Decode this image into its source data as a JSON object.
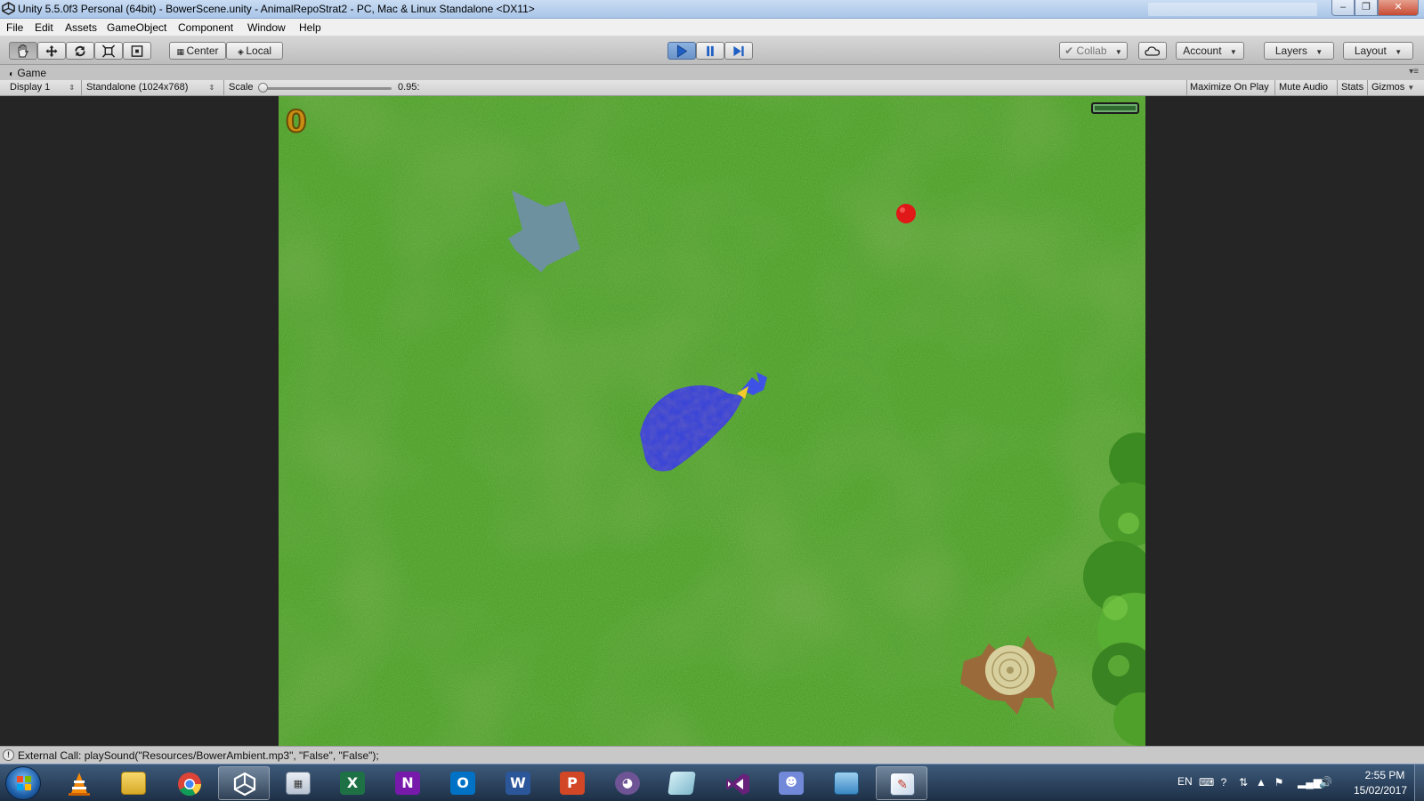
{
  "window": {
    "title": "Unity 5.5.0f3 Personal (64bit) - BowerScene.unity - AnimalRepoStrat2 - PC, Mac & Linux Standalone <DX11>",
    "minimize_glyph": "–",
    "maximize_glyph": "❐",
    "close_glyph": "✕"
  },
  "menu": [
    "File",
    "Edit",
    "Assets",
    "GameObject",
    "Component",
    "Window",
    "Help"
  ],
  "toolbar": {
    "tools": [
      "hand-icon",
      "move-icon",
      "rotate-icon",
      "scale-icon",
      "rect-icon"
    ],
    "pivot_label": "Center",
    "space_label": "Local",
    "play_state": "playing",
    "collab_label": "Collab",
    "account_label": "Account",
    "layers_label": "Layers",
    "layout_label": "Layout",
    "colors": {
      "play_active": "#6a93c9",
      "play_icon": "#1f5fc4"
    }
  },
  "game_tab": {
    "label": "Game",
    "display": "Display 1",
    "resolution": "Standalone (1024x768)",
    "scale_label": "Scale",
    "scale_value": "0.95:",
    "maximize_on_play": "Maximize On Play",
    "mute_audio": "Mute Audio",
    "stats": "Stats",
    "gizmos": "Gizmos"
  },
  "game": {
    "score": "0",
    "health_fraction": 1.0,
    "colors": {
      "grass": "#4c9e2a",
      "score": "#c98c12",
      "berry": "#e01818",
      "bird": "#3a45d6",
      "arrow": "#6f8fa8"
    }
  },
  "status": {
    "message": "External Call: playSound(\"Resources/BowerAmbient.mp3\", \"False\", \"False\");"
  },
  "taskbar": {
    "apps": [
      {
        "name": "vlc",
        "icon": "traffic-cone-icon"
      },
      {
        "name": "file-explorer",
        "icon": "folder-icon"
      },
      {
        "name": "chrome",
        "icon": "chrome-icon"
      },
      {
        "name": "unity",
        "icon": "unity-icon",
        "active": true
      },
      {
        "name": "calculator",
        "icon": "calculator-icon"
      },
      {
        "name": "excel",
        "icon": "excel-icon",
        "letter": "X"
      },
      {
        "name": "onenote",
        "icon": "onenote-icon",
        "letter": "N"
      },
      {
        "name": "outlook",
        "icon": "outlook-icon",
        "letter": "O"
      },
      {
        "name": "word",
        "icon": "word-icon",
        "letter": "W"
      },
      {
        "name": "powerpoint",
        "icon": "powerpoint-icon",
        "letter": "P"
      },
      {
        "name": "github",
        "icon": "github-cat-icon"
      },
      {
        "name": "notepad",
        "icon": "notepad-icon"
      },
      {
        "name": "visual-studio",
        "icon": "visual-studio-icon"
      },
      {
        "name": "discord",
        "icon": "discord-icon"
      },
      {
        "name": "photo-viewer",
        "icon": "photo-icon"
      },
      {
        "name": "paint",
        "icon": "paint-icon"
      }
    ],
    "language": "EN",
    "time": "2:55 PM",
    "date": "15/02/2017"
  }
}
